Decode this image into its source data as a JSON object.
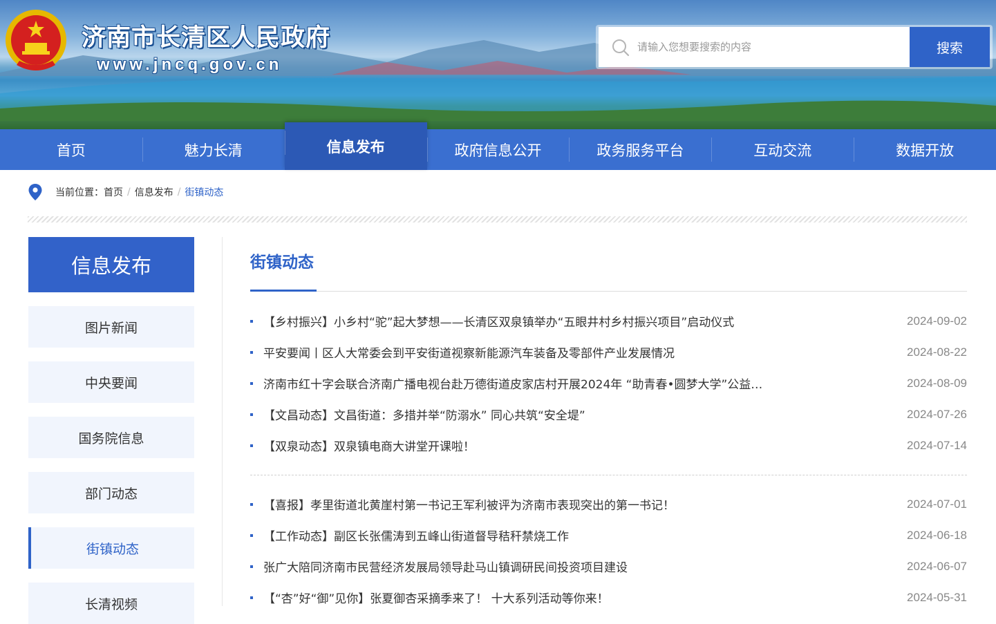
{
  "header": {
    "site_name": "济南市长清区人民政府",
    "site_url": "www.jncq.gov.cn",
    "search": {
      "placeholder": "请输入您想要搜索的内容",
      "button_label": "搜索"
    }
  },
  "nav": {
    "items": [
      {
        "label": "首页"
      },
      {
        "label": "魅力长清"
      },
      {
        "label": "信息发布",
        "active": true
      },
      {
        "label": "政府信息公开"
      },
      {
        "label": "政务服务平台"
      },
      {
        "label": "互动交流"
      },
      {
        "label": "数据开放"
      }
    ]
  },
  "breadcrumb": {
    "prefix": "当前位置：",
    "home": "首页",
    "sep": "/",
    "section": "信息发布",
    "current": "街镇动态"
  },
  "sidebar": {
    "title": "信息发布",
    "items": [
      {
        "label": "图片新闻"
      },
      {
        "label": "中央要闻"
      },
      {
        "label": "国务院信息"
      },
      {
        "label": "部门动态"
      },
      {
        "label": "街镇动态",
        "active": true
      },
      {
        "label": "长清视频"
      }
    ]
  },
  "content": {
    "title": "街镇动态",
    "groups": [
      [
        {
          "title": "【乡村振兴】小乡村“驼”起大梦想——长清区双泉镇举办“五眼井村乡村振兴项目”启动仪式",
          "date": "2024-09-02"
        },
        {
          "title": "平安要闻丨区人大常委会到平安街道视察新能源汽车装备及零部件产业发展情况",
          "date": "2024-08-22"
        },
        {
          "title": "济南市红十字会联合济南广播电视台赴万德街道皮家店村开展2024年 “助青春•圆梦大学”公益…",
          "date": "2024-08-09"
        },
        {
          "title": "【文昌动态】文昌街道：多措并举“防溺水” 同心共筑“安全堤”",
          "date": "2024-07-26"
        },
        {
          "title": "【双泉动态】双泉镇电商大讲堂开课啦！",
          "date": "2024-07-14"
        }
      ],
      [
        {
          "title": "【喜报】孝里街道北黄崖村第一书记王军利被评为济南市表现突出的第一书记！",
          "date": "2024-07-01"
        },
        {
          "title": "【工作动态】副区长张儒涛到五峰山街道督导秸秆禁烧工作",
          "date": "2024-06-18"
        },
        {
          "title": "张广大陪同济南市民营经济发展局领导赴马山镇调研民间投资项目建设",
          "date": "2024-06-07"
        },
        {
          "title": "【“杏”好“御”见你】张夏御杏采摘季来了！ 十大系列活动等你来！",
          "date": "2024-05-31"
        }
      ]
    ]
  },
  "colors": {
    "primary": "#3a6fd0",
    "accent": "#2f63c8",
    "sidebar_bg": "#f1f5fd"
  }
}
